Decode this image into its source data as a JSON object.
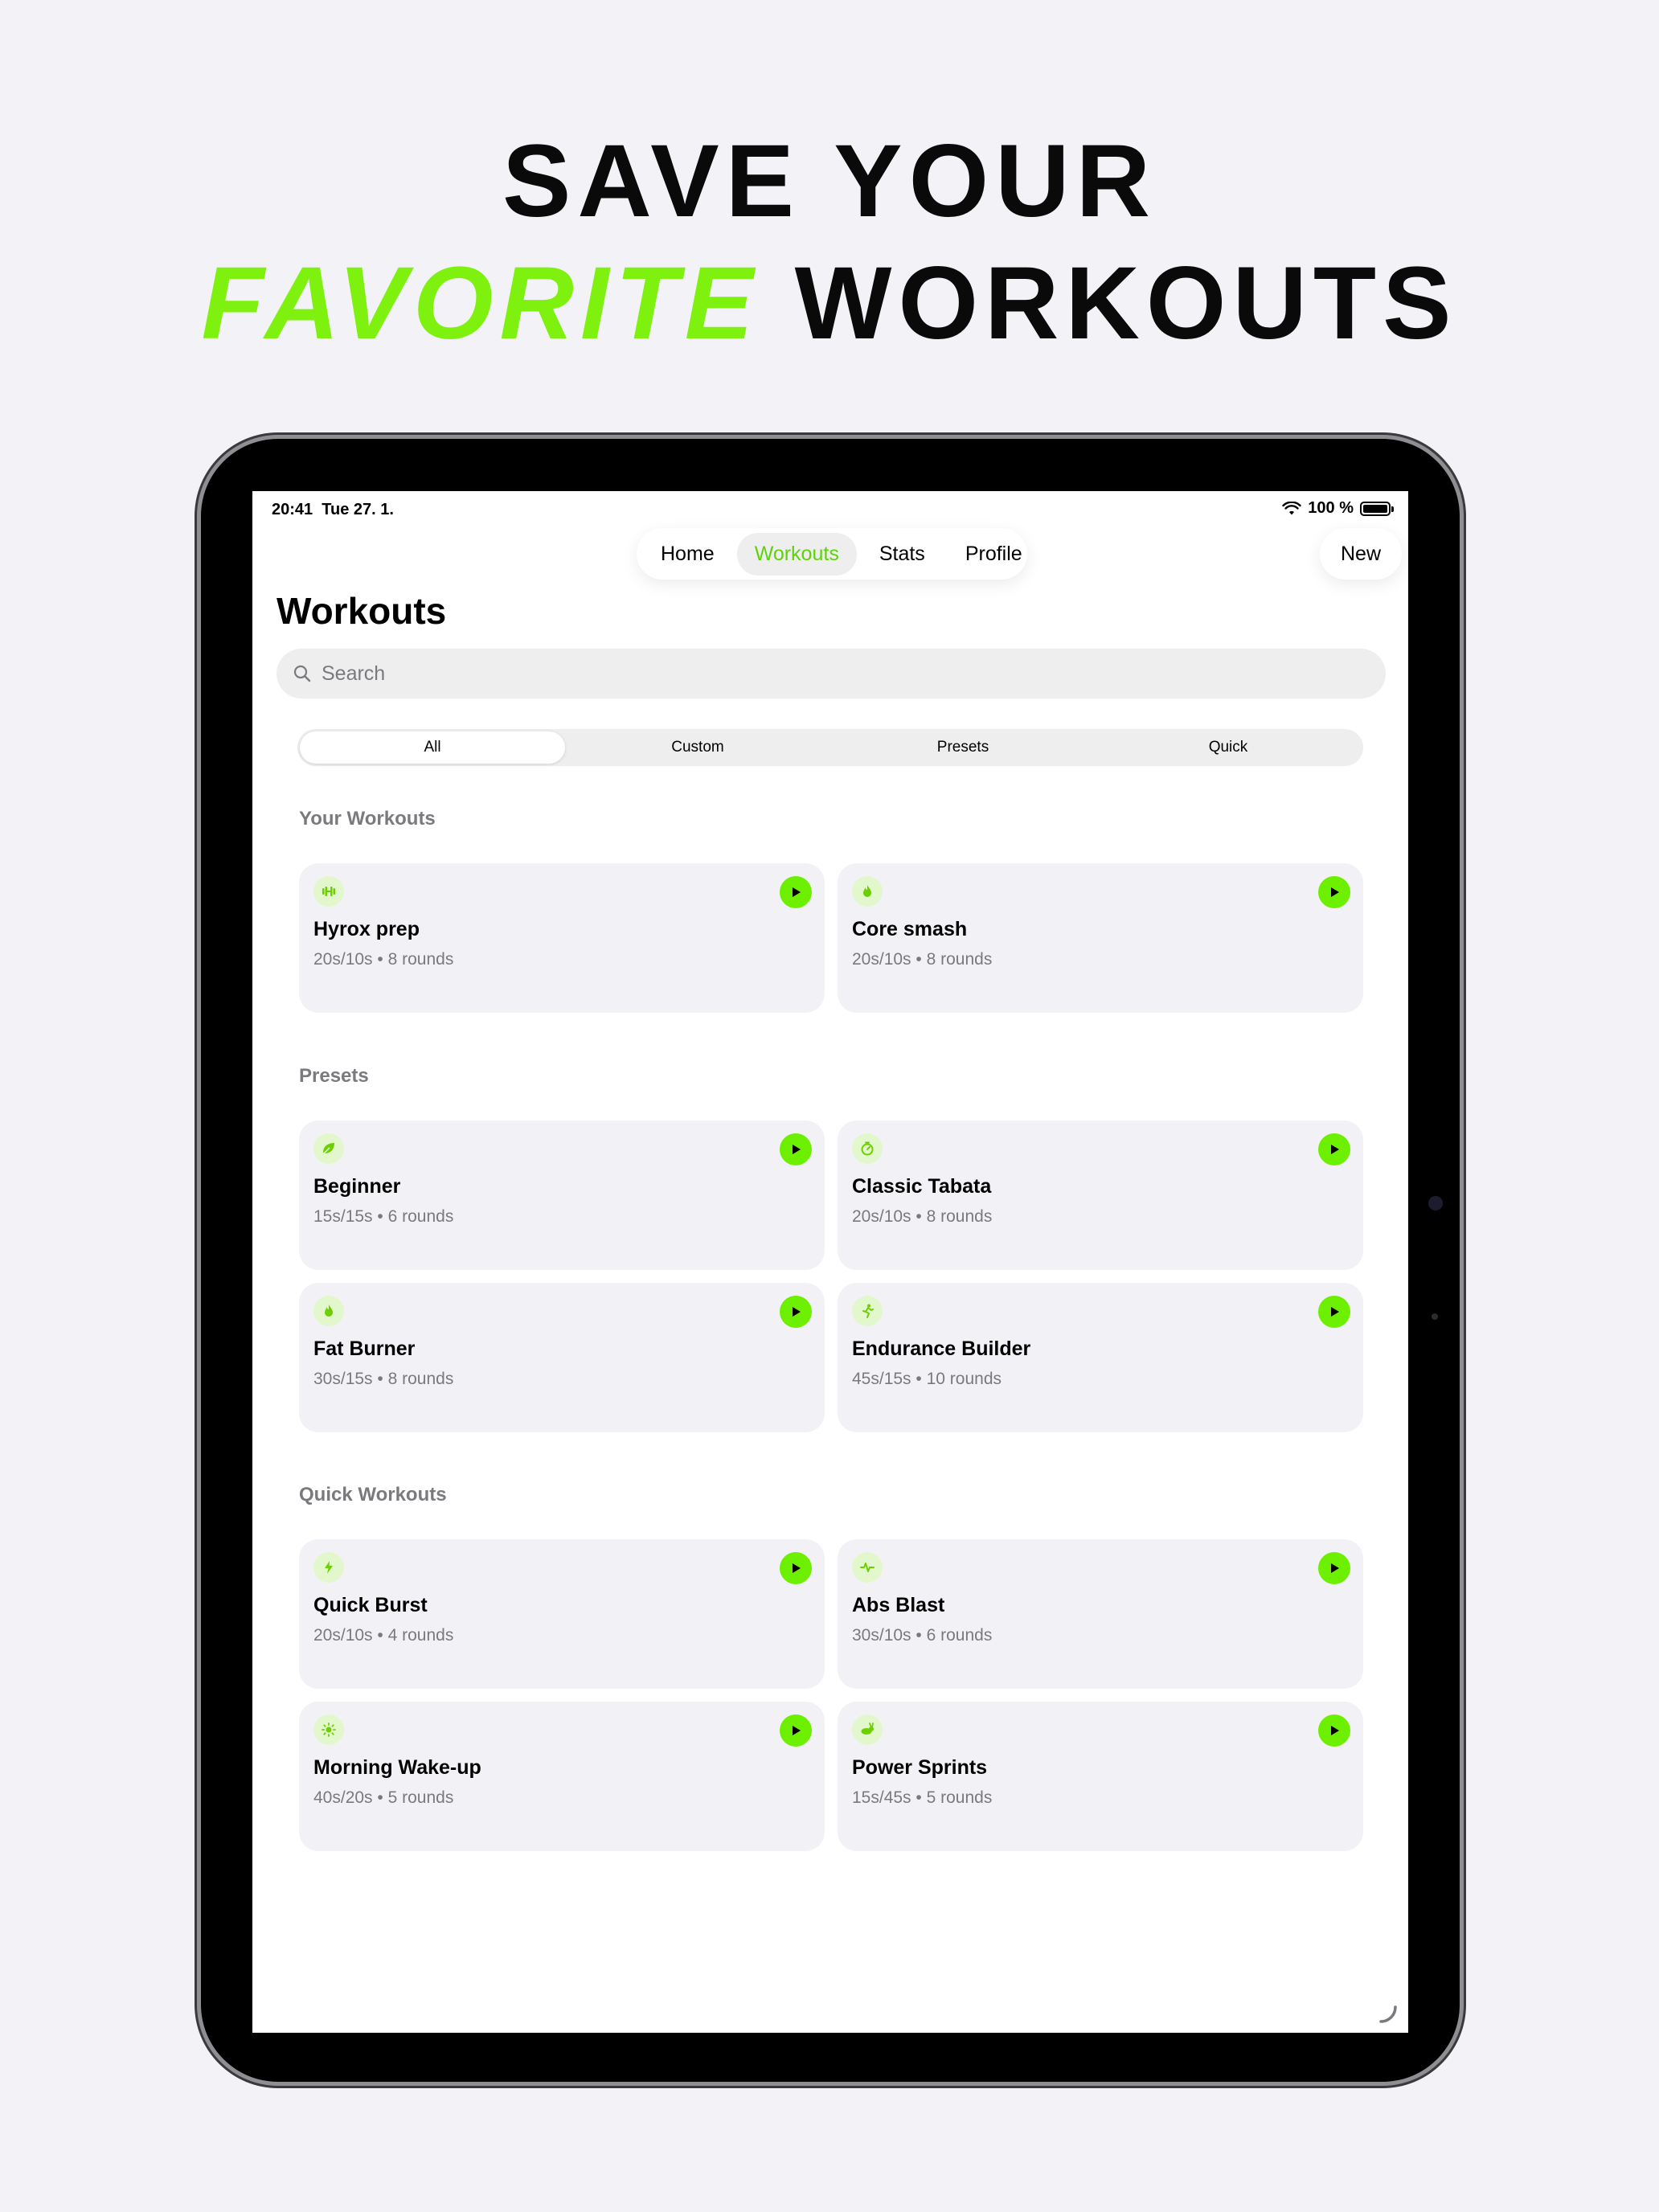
{
  "headline": {
    "line1": "SAVE YOUR",
    "accent": "FAVORITE",
    "rest": " WORKOUTS"
  },
  "colors": {
    "accent": "#7ef20e",
    "play": "#6cf000"
  },
  "status_bar": {
    "time": "20:41",
    "date": "Tue 27. 1.",
    "battery": "100 %"
  },
  "nav": {
    "tabs": [
      "Home",
      "Workouts",
      "Stats",
      "Profile"
    ],
    "active": "Workouts",
    "new_label": "New"
  },
  "page_title": "Workouts",
  "search": {
    "placeholder": "Search"
  },
  "segments": [
    "All",
    "Custom",
    "Presets",
    "Quick"
  ],
  "sections": [
    {
      "title": "Your Workouts",
      "cards": [
        {
          "title": "Hyrox prep",
          "timing": "20s/10s",
          "rounds": "8 rounds",
          "icon": "dumbbell-icon"
        },
        {
          "title": "Core smash",
          "timing": "20s/10s",
          "rounds": "8 rounds",
          "icon": "flame-icon"
        }
      ]
    },
    {
      "title": "Presets",
      "cards": [
        {
          "title": "Beginner",
          "timing": "15s/15s",
          "rounds": "6 rounds",
          "icon": "leaf-icon"
        },
        {
          "title": "Classic Tabata",
          "timing": "20s/10s",
          "rounds": "8 rounds",
          "icon": "timer-icon"
        },
        {
          "title": "Fat Burner",
          "timing": "30s/15s",
          "rounds": "8 rounds",
          "icon": "flame-icon"
        },
        {
          "title": "Endurance Builder",
          "timing": "45s/15s",
          "rounds": "10 rounds",
          "icon": "running-figure-icon"
        }
      ]
    },
    {
      "title": "Quick Workouts",
      "cards": [
        {
          "title": "Quick Burst",
          "timing": "20s/10s",
          "rounds": "4 rounds",
          "icon": "bolt-icon"
        },
        {
          "title": "Abs Blast",
          "timing": "30s/10s",
          "rounds": "6 rounds",
          "icon": "pulse-icon"
        },
        {
          "title": "Morning Wake-up",
          "timing": "40s/20s",
          "rounds": "5 rounds",
          "icon": "sun-icon"
        },
        {
          "title": "Power Sprints",
          "timing": "15s/45s",
          "rounds": "5 rounds",
          "icon": "hare-icon"
        }
      ]
    }
  ]
}
